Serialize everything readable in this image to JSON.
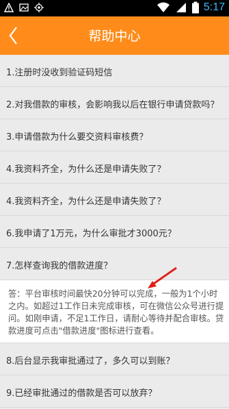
{
  "statusbar": {
    "time": "5:17"
  },
  "header": {
    "title": "帮助中心"
  },
  "faq": [
    "1.注册时没收到验证码短信",
    "2.对我借款的审核，会影响我以后在银行申请贷款吗？",
    "3.申请借款为什么要交资料审核费？",
    "4.我资料齐全，为什么还是申请失败了？",
    "4.我资料齐全，为什么还是申请失败了？",
    "6.我申请了1万元，为什么审批才3000元？",
    "7.怎样查询我的借款进度？",
    "8.后台显示我审批通过了，多久可以到账？",
    "9.已经审批通过的借款是否可以放弃？"
  ],
  "answer7": "答：平台审核时间最快20分钟可以完成，一般为1个小时之内。如超过1工作日未完成审核，可在微信公众号进行提问。如刚申请，不足1工作日，请耐心等待并配合审核。贷款进度可点击\"借款进度\"图标进行查看。",
  "colors": {
    "header": "#ff8c1a",
    "arrow": "#e0201c",
    "time": "#3fb6ff"
  }
}
